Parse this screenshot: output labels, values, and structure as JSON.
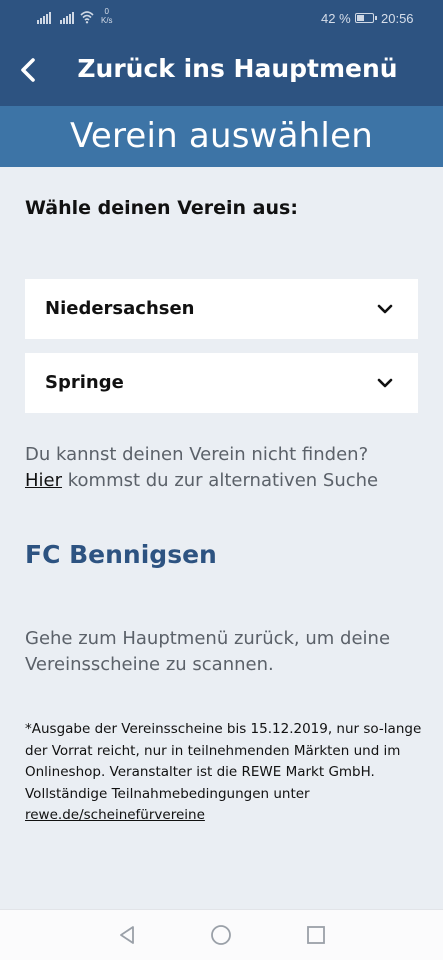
{
  "status_bar": {
    "net_speed_value": "0",
    "net_speed_unit": "K/s",
    "battery_text": "42 %",
    "battery_level": 0.42,
    "time": "20:56"
  },
  "header": {
    "back_icon": "chevron-left-icon",
    "title": "Zurück ins Hauptmenü"
  },
  "page": {
    "title": "Verein auswählen"
  },
  "form": {
    "prompt": "Wähle deinen Verein aus:",
    "state_select": {
      "value": "Niedersachsen",
      "icon": "chevron-down-icon"
    },
    "city_select": {
      "value": "Springe",
      "icon": "chevron-down-icon"
    }
  },
  "help": {
    "line1": "Du kannst deinen Verein nicht finden?",
    "link_text": "Hier",
    "line2": " kommst du zur alternativen Suche"
  },
  "selection": {
    "club_name": "FC Bennigsen"
  },
  "instruction": "Gehe zum Hauptmenü zurück, um deine Vereinsscheine zu scannen.",
  "disclaimer": {
    "text": "*Ausgabe der Vereinsscheine bis 15.12.2019, nur so-lange der Vorrat reicht, nur in teilnehmenden Märkten und im Onlineshop. Veranstalter ist die REWE Markt GmbH. Vollständige Teilnahmebedingungen unter",
    "link": "rewe.de/scheinefürvereine"
  },
  "colors": {
    "header_dark": "#2d5381",
    "header_light": "#3d74a6",
    "background": "#eaeef3",
    "club_name": "#2d5381"
  },
  "nav": {
    "back": "triangle-back-icon",
    "home": "circle-home-icon",
    "recents": "square-recents-icon"
  }
}
